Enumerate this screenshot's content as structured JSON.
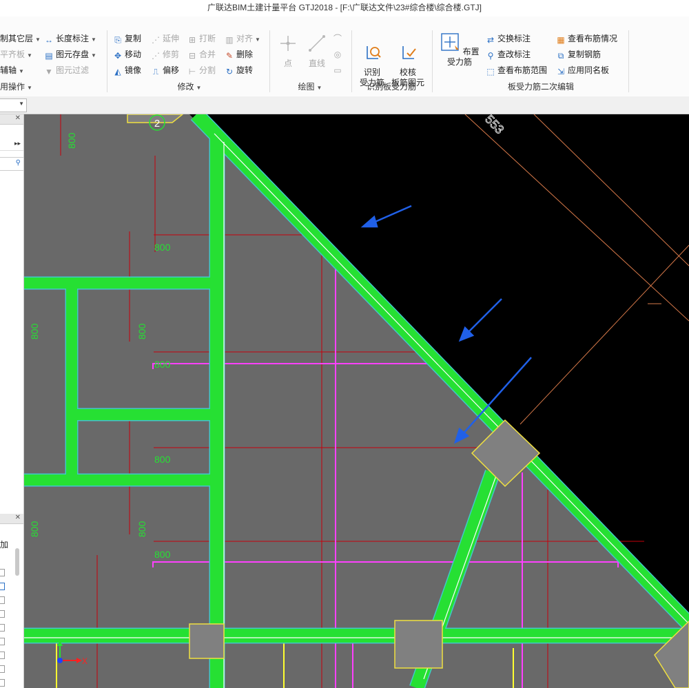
{
  "window": {
    "title": "广联达BIM土建计量平台 GTJ2018 - [F:\\广联达文件\\23#综合楼\\综合楼.GTJ]"
  },
  "ribbon": {
    "common_ops": {
      "copy_floor": "制其它层",
      "align_board": "平齐板",
      "aux_axis": "辅轴",
      "group_label": "用操作"
    },
    "common_tools": {
      "length_dim": "长度标注",
      "element_store": "图元存盘",
      "element_filter": "图元过滤"
    },
    "modify": {
      "copy": "复制",
      "extend": "延伸",
      "break": "打断",
      "align": "对齐",
      "move": "移动",
      "trim": "修剪",
      "merge": "合并",
      "delete": "删除",
      "mirror": "镜像",
      "offset": "偏移",
      "split": "分割",
      "rotate": "旋转",
      "group_label": "修改"
    },
    "draw": {
      "point": "点",
      "line": "直线",
      "group_label": "绘图"
    },
    "identify": {
      "identify_btn": "识别\n受力筋",
      "check_btn": "校核\n板筋图元",
      "group_label": "识别板受力筋"
    },
    "rebar_edit": {
      "place_rebar": "布置受力筋",
      "swap_label": "交换标注",
      "check_edit_label": "查改标注",
      "view_range": "查看布筋范围",
      "view_status": "查看布筋情况",
      "copy_rebar": "复制钢筋",
      "apply_same": "应用同名板",
      "group_label": "板受力筋二次编辑"
    }
  },
  "left_panel": {
    "add_label": "加"
  },
  "canvas": {
    "axis_number": "2",
    "axis_label_553": "553",
    "dim_labels_vertical": [
      "800",
      "800",
      "800",
      "800",
      "800"
    ],
    "dim_labels_horizontal": [
      "800",
      "800",
      "800",
      "800"
    ],
    "coord_x_label": "X",
    "colors": {
      "background": "#000000",
      "slab_fill": "#696969",
      "beam": "#26e033",
      "beam_edge": "#41c8c8",
      "rebar_pink": "#ff40ff",
      "redline": "#c8000a",
      "column": "#808080",
      "column_border": "#f0e040",
      "arrow": "#2060e8",
      "orange_line": "#d97a4a",
      "yellow_line": "#ffff30"
    }
  }
}
